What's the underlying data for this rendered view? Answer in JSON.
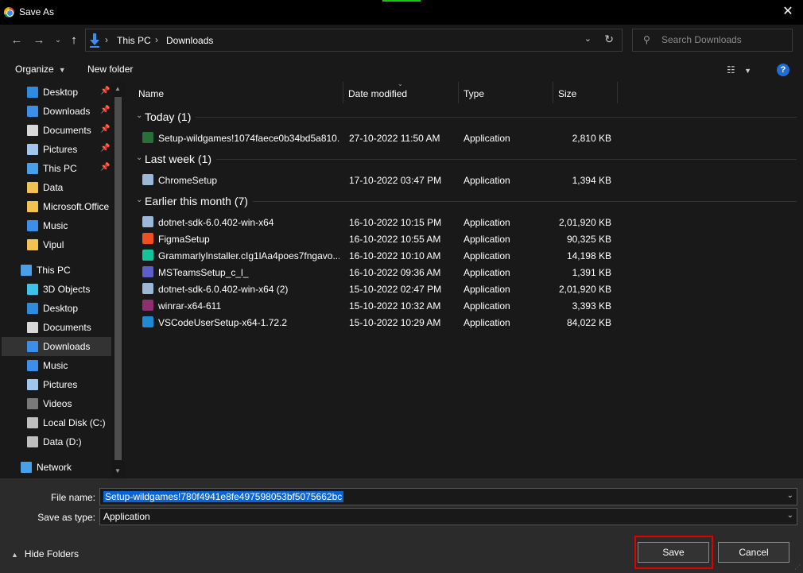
{
  "window": {
    "title": "Save As",
    "close_glyph": "✕"
  },
  "address": {
    "crumbs": [
      "This PC",
      "Downloads"
    ],
    "search_placeholder": "Search Downloads"
  },
  "toolbar": {
    "organize": "Organize",
    "new_folder": "New folder",
    "help": "?"
  },
  "sidebar": {
    "quick_access": [
      {
        "label": "Desktop",
        "icon": "desktop-icon",
        "pinned": true
      },
      {
        "label": "Downloads",
        "icon": "download-folder-icon",
        "pinned": true
      },
      {
        "label": "Documents",
        "icon": "documents-icon",
        "pinned": true
      },
      {
        "label": "Pictures",
        "icon": "pictures-icon",
        "pinned": true
      },
      {
        "label": "This PC",
        "icon": "this-pc-icon",
        "pinned": true
      },
      {
        "label": "Data",
        "icon": "folder-icon",
        "pinned": false
      },
      {
        "label": "Microsoft.Office",
        "icon": "folder-icon",
        "pinned": false
      },
      {
        "label": "Music",
        "icon": "music-icon",
        "pinned": false
      },
      {
        "label": "Vipul",
        "icon": "folder-icon",
        "pinned": false
      }
    ],
    "this_pc": "This PC",
    "this_pc_items": [
      {
        "label": "3D Objects",
        "icon": "3d-objects-icon"
      },
      {
        "label": "Desktop",
        "icon": "desktop-icon"
      },
      {
        "label": "Documents",
        "icon": "documents-icon"
      },
      {
        "label": "Downloads",
        "icon": "download-folder-icon",
        "selected": true
      },
      {
        "label": "Music",
        "icon": "music-icon"
      },
      {
        "label": "Pictures",
        "icon": "pictures-icon"
      },
      {
        "label": "Videos",
        "icon": "videos-icon"
      },
      {
        "label": "Local Disk (C:)",
        "icon": "local-disk-icon"
      },
      {
        "label": "Data (D:)",
        "icon": "drive-icon"
      }
    ],
    "network": "Network"
  },
  "columns": [
    "Name",
    "Date modified",
    "Type",
    "Size"
  ],
  "groups": [
    {
      "title": "Today (1)",
      "files": [
        {
          "name": "Setup-wildgames!1074faece0b34bd5a810...",
          "date": "27-10-2022 11:50 AM",
          "type": "Application",
          "size": "2,810 KB",
          "icon": "wildgames-icon",
          "color": "#2a6f3a"
        }
      ]
    },
    {
      "title": "Last week (1)",
      "files": [
        {
          "name": "ChromeSetup",
          "date": "17-10-2022 03:47 PM",
          "type": "Application",
          "size": "1,394 KB",
          "icon": "installer-icon",
          "color": "#9bb8d8"
        }
      ]
    },
    {
      "title": "Earlier this month (7)",
      "files": [
        {
          "name": "dotnet-sdk-6.0.402-win-x64",
          "date": "16-10-2022 10:15 PM",
          "type": "Application",
          "size": "2,01,920 KB",
          "icon": "installer-icon",
          "color": "#9bb8d8"
        },
        {
          "name": "FigmaSetup",
          "date": "16-10-2022 10:55 AM",
          "type": "Application",
          "size": "90,325 KB",
          "icon": "figma-icon",
          "color": "#f24e1e"
        },
        {
          "name": "GrammarlyInstaller.cIg1lAa4poes7fngavo...",
          "date": "16-10-2022 10:10 AM",
          "type": "Application",
          "size": "14,198 KB",
          "icon": "grammarly-icon",
          "color": "#15c39a"
        },
        {
          "name": "MSTeamsSetup_c_l_",
          "date": "16-10-2022 09:36 AM",
          "type": "Application",
          "size": "1,391 KB",
          "icon": "teams-icon",
          "color": "#5b5fc7"
        },
        {
          "name": "dotnet-sdk-6.0.402-win-x64 (2)",
          "date": "15-10-2022 02:47 PM",
          "type": "Application",
          "size": "2,01,920 KB",
          "icon": "installer-icon",
          "color": "#9bb8d8"
        },
        {
          "name": "winrar-x64-611",
          "date": "15-10-2022 10:32 AM",
          "type": "Application",
          "size": "3,393 KB",
          "icon": "winrar-icon",
          "color": "#8e2f6f"
        },
        {
          "name": "VSCodeUserSetup-x64-1.72.2",
          "date": "15-10-2022 10:29 AM",
          "type": "Application",
          "size": "84,022 KB",
          "icon": "vscode-icon",
          "color": "#1f8ad2"
        }
      ]
    }
  ],
  "bottom": {
    "file_name_label": "File name:",
    "file_name_value": "Setup-wildgames!780f4941e8fe497598053bf5075662bc",
    "save_as_type_label": "Save as type:",
    "save_as_type_value": "Application",
    "hide_folders": "Hide Folders",
    "save": "Save",
    "cancel": "Cancel"
  },
  "colors": {
    "background": "#191919",
    "panel": "#2b2b2b",
    "selection": "#0a64d8",
    "highlight_outline": "#e00000",
    "accent": "#16c60c"
  }
}
